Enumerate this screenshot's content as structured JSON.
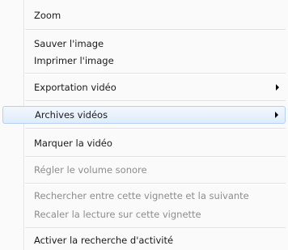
{
  "menu": {
    "items": [
      {
        "label": "Zoom"
      },
      {
        "label": "Sauver l'image"
      },
      {
        "label": "Imprimer l'image"
      },
      {
        "label": "Exportation vidéo"
      },
      {
        "label": "Archives vidéos"
      },
      {
        "label": "Marquer la vidéo"
      },
      {
        "label": "Régler le volume sonore"
      },
      {
        "label": "Rechercher entre cette vignette et la suivante"
      },
      {
        "label": "Recaler la lecture sur cette vignette"
      },
      {
        "label": "Activer la recherche d'activité"
      }
    ]
  }
}
